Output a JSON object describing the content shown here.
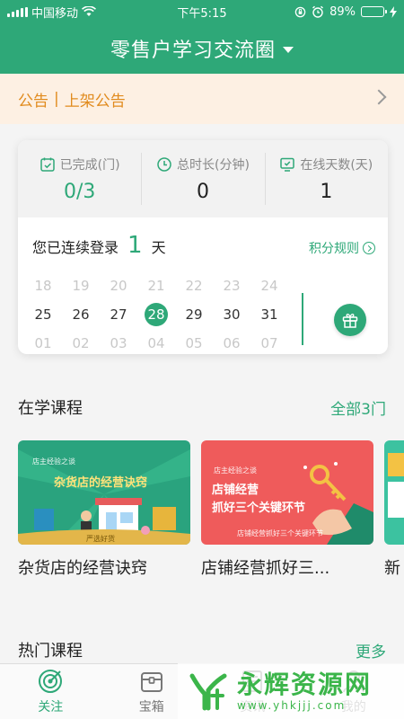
{
  "status_bar": {
    "carrier": "中国移动",
    "time": "下午5:15",
    "battery": "89%",
    "battery_level": 0.89
  },
  "header": {
    "title": "零售户学习交流圈"
  },
  "notice": {
    "label": "公告",
    "separator": "|",
    "text": "上架公告"
  },
  "stats": [
    {
      "icon": "calendar-check-icon",
      "label": "已完成(门)",
      "value": "0/3"
    },
    {
      "icon": "clock-icon",
      "label": "总时长(分钟)",
      "value": "0"
    },
    {
      "icon": "monitor-check-icon",
      "label": "在线天数(天)",
      "value": "1"
    }
  ],
  "streak": {
    "prefix": "您已连续登录",
    "count": "1",
    "suffix": "天",
    "rules_label": "积分规则"
  },
  "calendar": {
    "rows": [
      [
        "18",
        "19",
        "20",
        "21",
        "22",
        "23",
        "24"
      ],
      [
        "25",
        "26",
        "27",
        "28",
        "29",
        "30",
        "31"
      ],
      [
        "01",
        "02",
        "03",
        "04",
        "05",
        "06",
        "07"
      ]
    ],
    "today": "28"
  },
  "learning": {
    "title": "在学课程",
    "all_link": "全部3门"
  },
  "courses": [
    {
      "name": "杂货店的经营诀窍",
      "cover_title": "杂货店的经营诀窍",
      "cover_tag": "店主经验之谈",
      "cover_bottom": "严选好货",
      "cover_color": "#2aa37e"
    },
    {
      "name": "店铺经营抓好三...",
      "cover_title": "店铺经营",
      "cover_sub": "抓好三个关键环节",
      "cover_tag": "店主经验之谈",
      "cover_bottom": "店铺经营抓好三个关键环节",
      "cover_color": "#ef5b5b"
    },
    {
      "name": "新",
      "cover_color": "#3cc2a0"
    }
  ],
  "hot": {
    "title": "热门课程",
    "more_link": "更多"
  },
  "tabs": [
    {
      "label": "关注",
      "icon": "target-icon",
      "active": true
    },
    {
      "label": "宝箱",
      "icon": "treasure-box-icon",
      "active": false
    },
    {
      "label": "资讯",
      "icon": "news-icon",
      "active": false
    },
    {
      "label": "我的",
      "icon": "person-icon",
      "active": false
    }
  ],
  "watermark": {
    "title": "永辉资源网",
    "url": "www.yhkjjj.com"
  },
  "colors": {
    "primary": "#2ea878",
    "notice_bg": "#fdf0e3",
    "notice_text": "#e18b1e"
  }
}
